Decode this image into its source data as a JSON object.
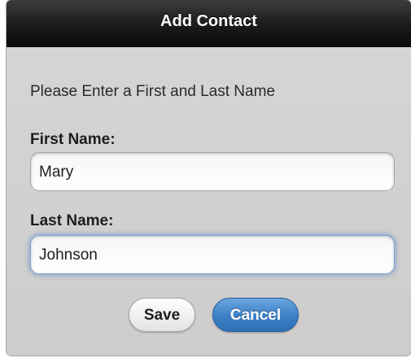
{
  "dialog": {
    "title": "Add Contact",
    "instructions": "Please Enter a First and Last Name",
    "first_name": {
      "label": "First Name:",
      "value": "Mary"
    },
    "last_name": {
      "label": "Last Name:",
      "value": "Johnson"
    },
    "buttons": {
      "save_label": "Save",
      "cancel_label": "Cancel"
    }
  },
  "colors": {
    "titlebar": "#111111",
    "dialog_background": "#d4d2d0",
    "accent_button": "#3d7fc5",
    "focus_glow": "#5d8ecc"
  }
}
